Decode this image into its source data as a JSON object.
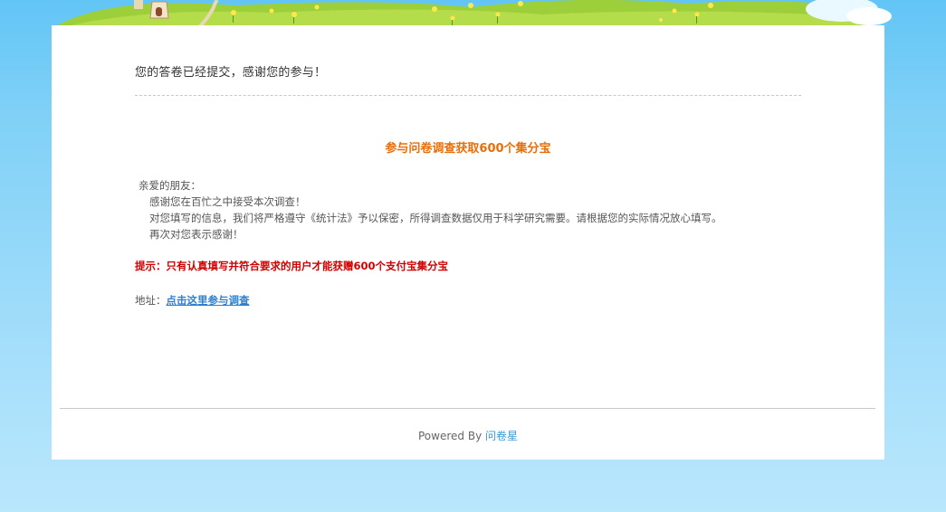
{
  "result": {
    "submitted_message": "您的答卷已经提交，感谢您的参与！"
  },
  "promo": {
    "headline": "参与问卷调查获取600个集分宝",
    "greeting": "亲爱的朋友：",
    "lines": [
      "感谢您在百忙之中接受本次调查！",
      "对您填写的信息，我们将严格遵守《统计法》予以保密，所得调查数据仅用于科学研究需要。请根据您的实际情况放心填写。",
      "再次对您表示感谢！"
    ],
    "tip": "提示：只有认真填写并符合要求的用户才能获赠600个支付宝集分宝",
    "address_label": "地址：",
    "address_link": "点击这里参与调查"
  },
  "footer": {
    "powered_by": "Powered By ",
    "brand": "问卷星"
  },
  "colors": {
    "headline": "#e86e0a",
    "tip": "#d10000",
    "link": "#2e7fd1",
    "brand_link": "#3a9ad9",
    "sky": "#7fd0f7"
  }
}
